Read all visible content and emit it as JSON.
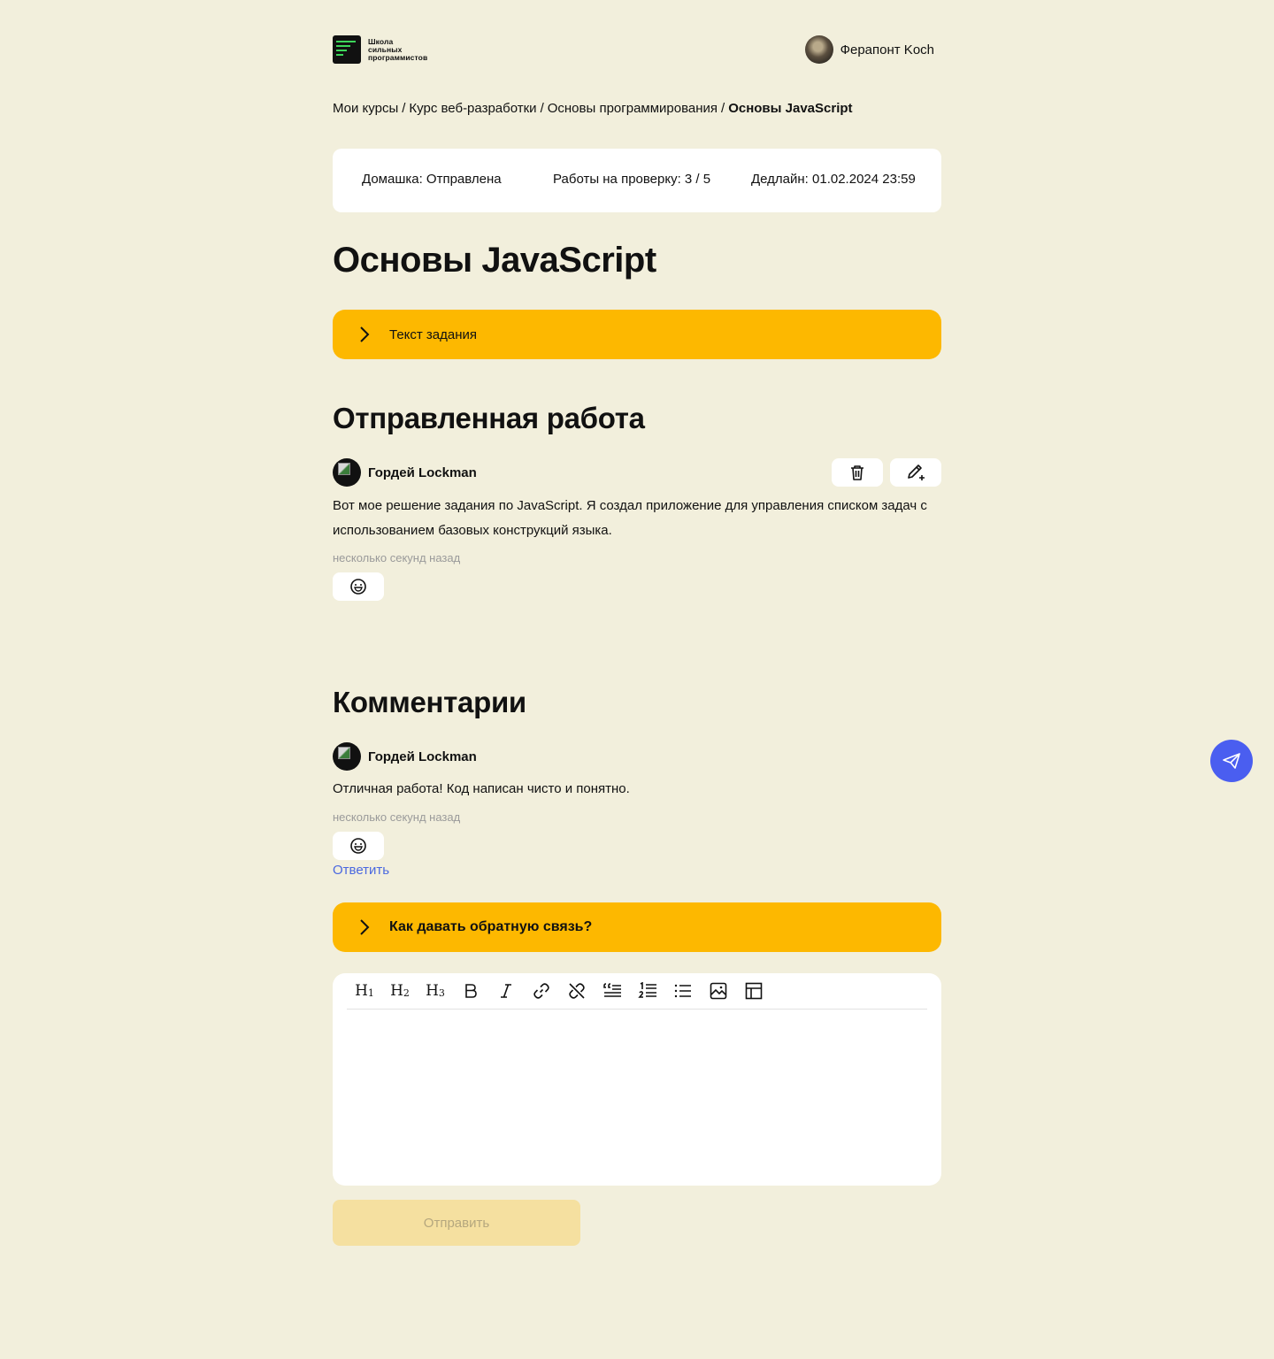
{
  "header": {
    "logo_line1": "Школа",
    "logo_line2": "сильных",
    "logo_line3": "программистов",
    "user_name": "Ферапонт Koch"
  },
  "breadcrumb": {
    "items": [
      "Мои курсы",
      "Курс веб-разработки",
      "Основы программирования"
    ],
    "separator": "/",
    "current": "Основы JavaScript"
  },
  "status": {
    "homework": "Домашка: Отправлена",
    "reviews": "Работы на проверку: 3 / 5",
    "deadline": "Дедлайн: 01.02.2024 23:59"
  },
  "page_title": "Основы JavaScript",
  "task_accordion": {
    "label": "Текст задания"
  },
  "submission": {
    "heading": "Отправленная работа",
    "author": "Гордей Lockman",
    "text": "Вот мое решение задания по JavaScript. Я создал приложение для управления списком задач с использованием базовых конструкций языка.",
    "time": "несколько секунд назад"
  },
  "comments": {
    "heading": "Комментарии",
    "items": [
      {
        "author": "Гордей Lockman",
        "text": "Отличная работа! Код написан чисто и понятно.",
        "time": "несколько секунд назад",
        "reply": "Ответить"
      }
    ]
  },
  "feedback_accordion": {
    "label": "Как давать обратную связь?"
  },
  "editor": {
    "toolbar": [
      "H1",
      "H2",
      "H3",
      "bold",
      "italic",
      "link",
      "unlink",
      "quote",
      "ordered-list",
      "bullet-list",
      "image",
      "table"
    ],
    "submit_label": "Отправить"
  },
  "colors": {
    "background": "#f2efdc",
    "accent_yellow": "#fdb800",
    "link_blue": "#4a68e0",
    "float_button": "#4a5ef0"
  }
}
